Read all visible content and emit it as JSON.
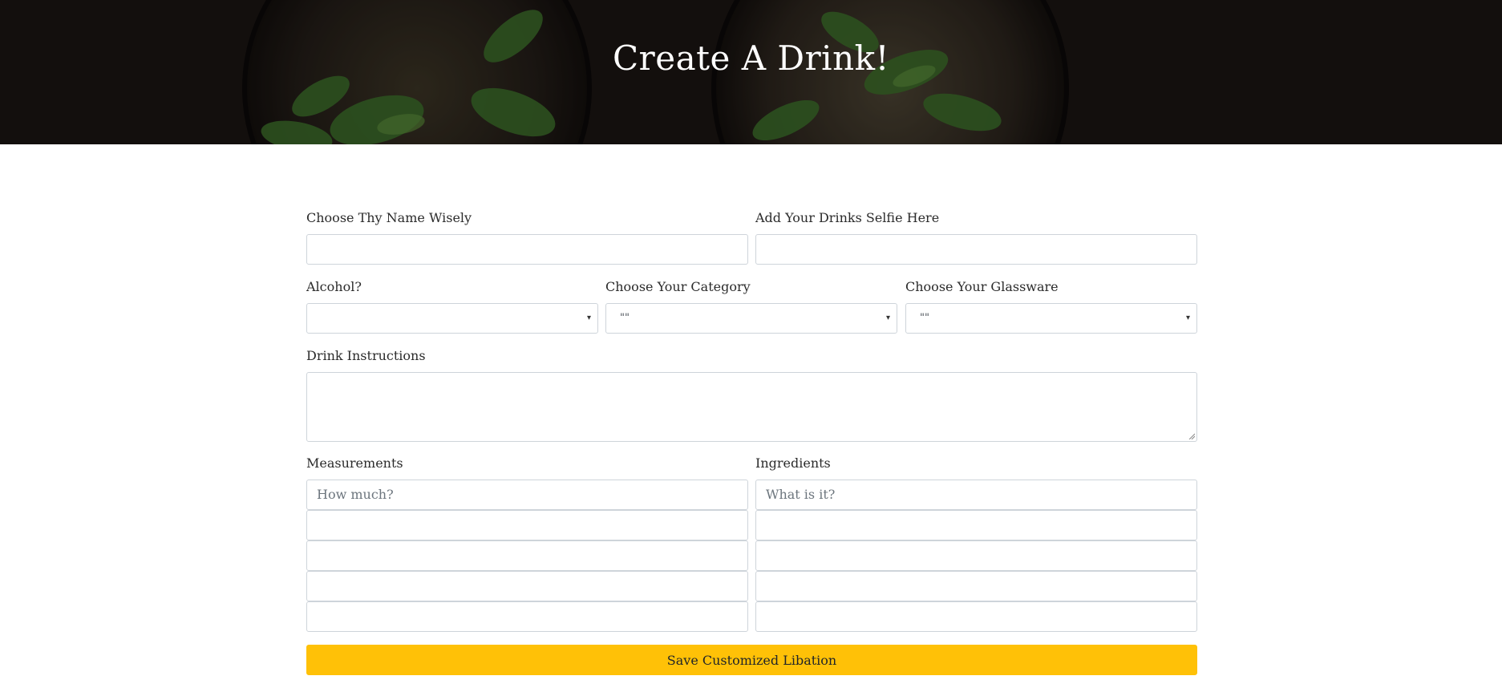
{
  "hero": {
    "title": "Create A Drink!"
  },
  "form": {
    "name_label": "Choose Thy Name Wisely",
    "selfie_label": "Add Your Drinks Selfie Here",
    "alcohol_label": "Alcohol?",
    "alcohol_value": "",
    "category_label": "Choose Your Category",
    "category_value": "\"\"",
    "glassware_label": "Choose Your Glassware",
    "glassware_value": "\"\"",
    "instructions_label": "Drink Instructions",
    "measurements_label": "Measurements",
    "measurements_placeholder": "How much?",
    "ingredients_label": "Ingredients",
    "ingredients_placeholder": "What is it?",
    "save_label": "Save Customized Libation"
  },
  "icons": {
    "select_caret": "caret-down-icon",
    "resize": "resize-handle-icon"
  },
  "colors": {
    "accent": "#ffc107",
    "hero_bg": "#1a1412",
    "border": "#ced4da"
  }
}
